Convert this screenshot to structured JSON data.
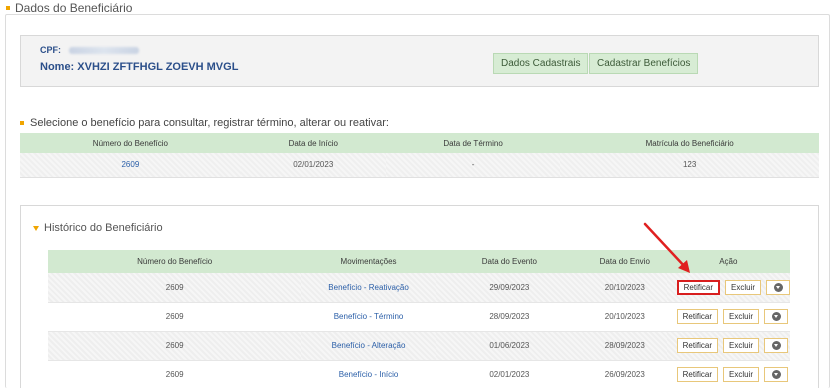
{
  "header": {
    "title": "Dados do Beneficiário"
  },
  "beneficiary": {
    "cpf_label": "CPF:",
    "name_label": "Nome:",
    "name_value": "XVHZI ZFTFHGL ZOEVH MVGL",
    "buttons": {
      "dados": "Dados Cadastrais",
      "cadastrar": "Cadastrar Benefícios"
    }
  },
  "selection": {
    "title": "Selecione o benefício para consultar, registrar término, alterar ou reativar:",
    "columns": [
      "Número do Benefício",
      "Data de Início",
      "Data de Término",
      "Matrícula do Beneficiário"
    ],
    "row": {
      "numero": "2609",
      "inicio": "02/01/2023",
      "termino": "-",
      "matricula": "123"
    }
  },
  "history": {
    "title": "Histórico do Beneficiário",
    "columns": [
      "Número do Benefício",
      "Movimentações",
      "Data do Evento",
      "Data do Envio",
      "Ação"
    ],
    "rows": [
      {
        "numero": "2609",
        "mov": "Benefício - Reativação",
        "evento": "29/09/2023",
        "envio": "20/10/2023"
      },
      {
        "numero": "2609",
        "mov": "Benefício - Término",
        "evento": "28/09/2023",
        "envio": "20/10/2023"
      },
      {
        "numero": "2609",
        "mov": "Benefício - Alteração",
        "evento": "01/06/2023",
        "envio": "28/09/2023"
      },
      {
        "numero": "2609",
        "mov": "Benefício - Início",
        "evento": "02/01/2023",
        "envio": "26/09/2023"
      }
    ],
    "actions": {
      "retificar": "Retificar",
      "excluir": "Excluir"
    }
  },
  "colors": {
    "accent": "#f0a500",
    "header_green": "#d2e9d0",
    "link": "#2b5fa8",
    "highlight": "#d81e1e"
  },
  "icons": {
    "download": "download-circle-icon",
    "arrow": "red-pointer-arrow"
  }
}
